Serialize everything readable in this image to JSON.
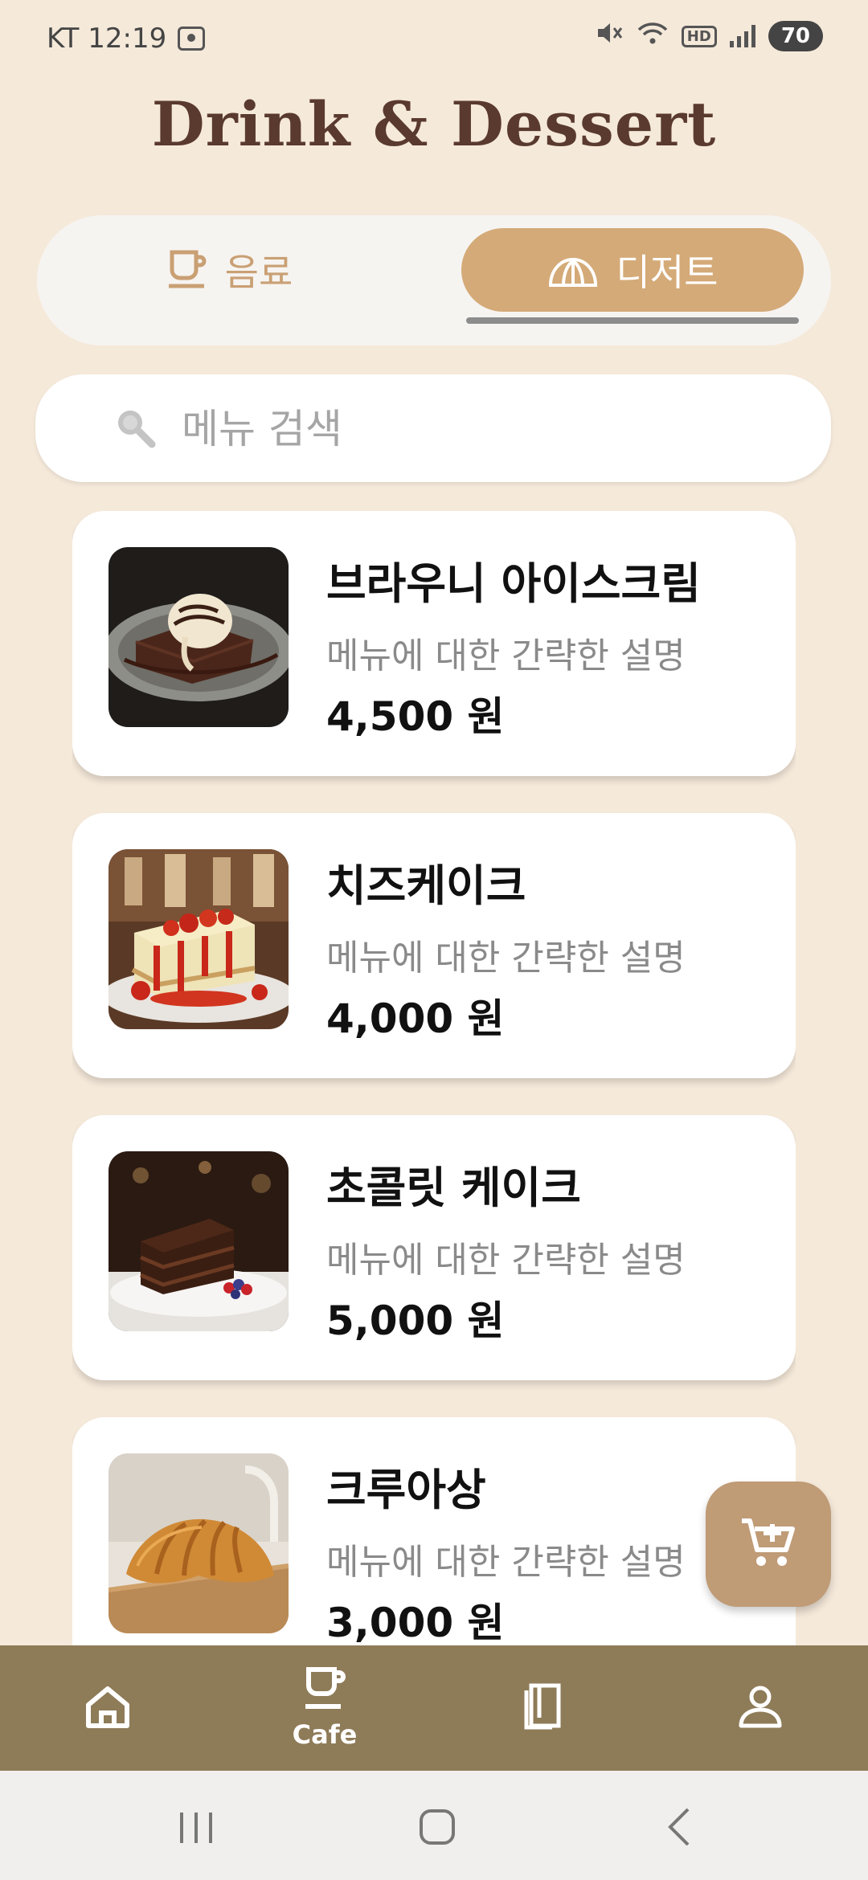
{
  "status_bar": {
    "carrier_time": "KT 12:19",
    "battery": "70",
    "hd_label": "HD"
  },
  "app_title": "Drink & Dessert",
  "categories": {
    "drink_label": "음료",
    "dessert_label": "디저트",
    "selected": "dessert"
  },
  "search": {
    "placeholder": "메뉴 검색"
  },
  "menu_items": [
    {
      "name": "브라우니 아이스크림",
      "description": "메뉴에 대한 간략한 설명",
      "price": "4,500 원",
      "image": "brownie-icecream"
    },
    {
      "name": "치즈케이크",
      "description": "메뉴에 대한 간략한 설명",
      "price": "4,000 원",
      "image": "cheesecake"
    },
    {
      "name": "초콜릿 케이크",
      "description": "메뉴에 대한 간략한 설명",
      "price": "5,000 원",
      "image": "chocolate-cake"
    },
    {
      "name": "크루아상",
      "description": "메뉴에 대한 간략한 설명",
      "price": "3,000 원",
      "image": "croissant"
    }
  ],
  "bottom_nav": {
    "items": [
      {
        "icon": "home-icon",
        "label": ""
      },
      {
        "icon": "cup-icon",
        "label": "Cafe"
      },
      {
        "icon": "book-icon",
        "label": ""
      },
      {
        "icon": "person-icon",
        "label": ""
      }
    ],
    "active": "Cafe"
  },
  "colors": {
    "background": "#f5e9da",
    "accent": "#d4aa78",
    "nav_bar": "#8e7b58",
    "title": "#5a3a2e",
    "cart_button": "#bf9b76"
  }
}
